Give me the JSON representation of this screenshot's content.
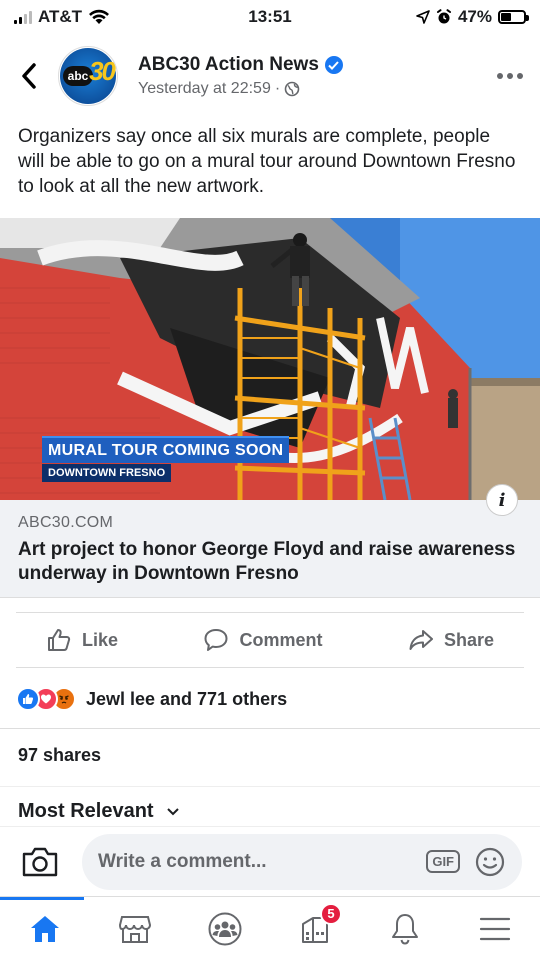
{
  "status_bar": {
    "carrier": "AT&T",
    "time": "13:51",
    "battery_percent": "47%",
    "battery_level": 0.47
  },
  "post": {
    "page_name": "ABC30 Action News",
    "logo_abc": "abc",
    "logo_number": "30",
    "time": "Yesterday at 22:59",
    "text": "Organizers say once all six murals are complete, people will be able to go on a mural tour around Downtown Fresno to look at all the new artwork.",
    "video_overlay": {
      "headline": "MURAL TOUR COMING SOON",
      "subheadline": "DOWNTOWN FRESNO"
    },
    "link": {
      "domain": "ABC30.COM",
      "title": "Art project to honor George Floyd and raise awareness underway in Downtown Fresno"
    }
  },
  "actions": {
    "like": "Like",
    "comment": "Comment",
    "share": "Share"
  },
  "reactions": {
    "text": "Jewl lee and 771 others"
  },
  "shares": "97 shares",
  "comments_sort": "Most Relevant",
  "comment_bar": {
    "placeholder": "Write a comment...",
    "gif": "GIF"
  },
  "bottom_nav": {
    "notifications_badge": "5"
  },
  "colors": {
    "facebook_blue": "#1877f2",
    "secondary_text": "#65676b",
    "badge_red": "#e41e3f"
  }
}
